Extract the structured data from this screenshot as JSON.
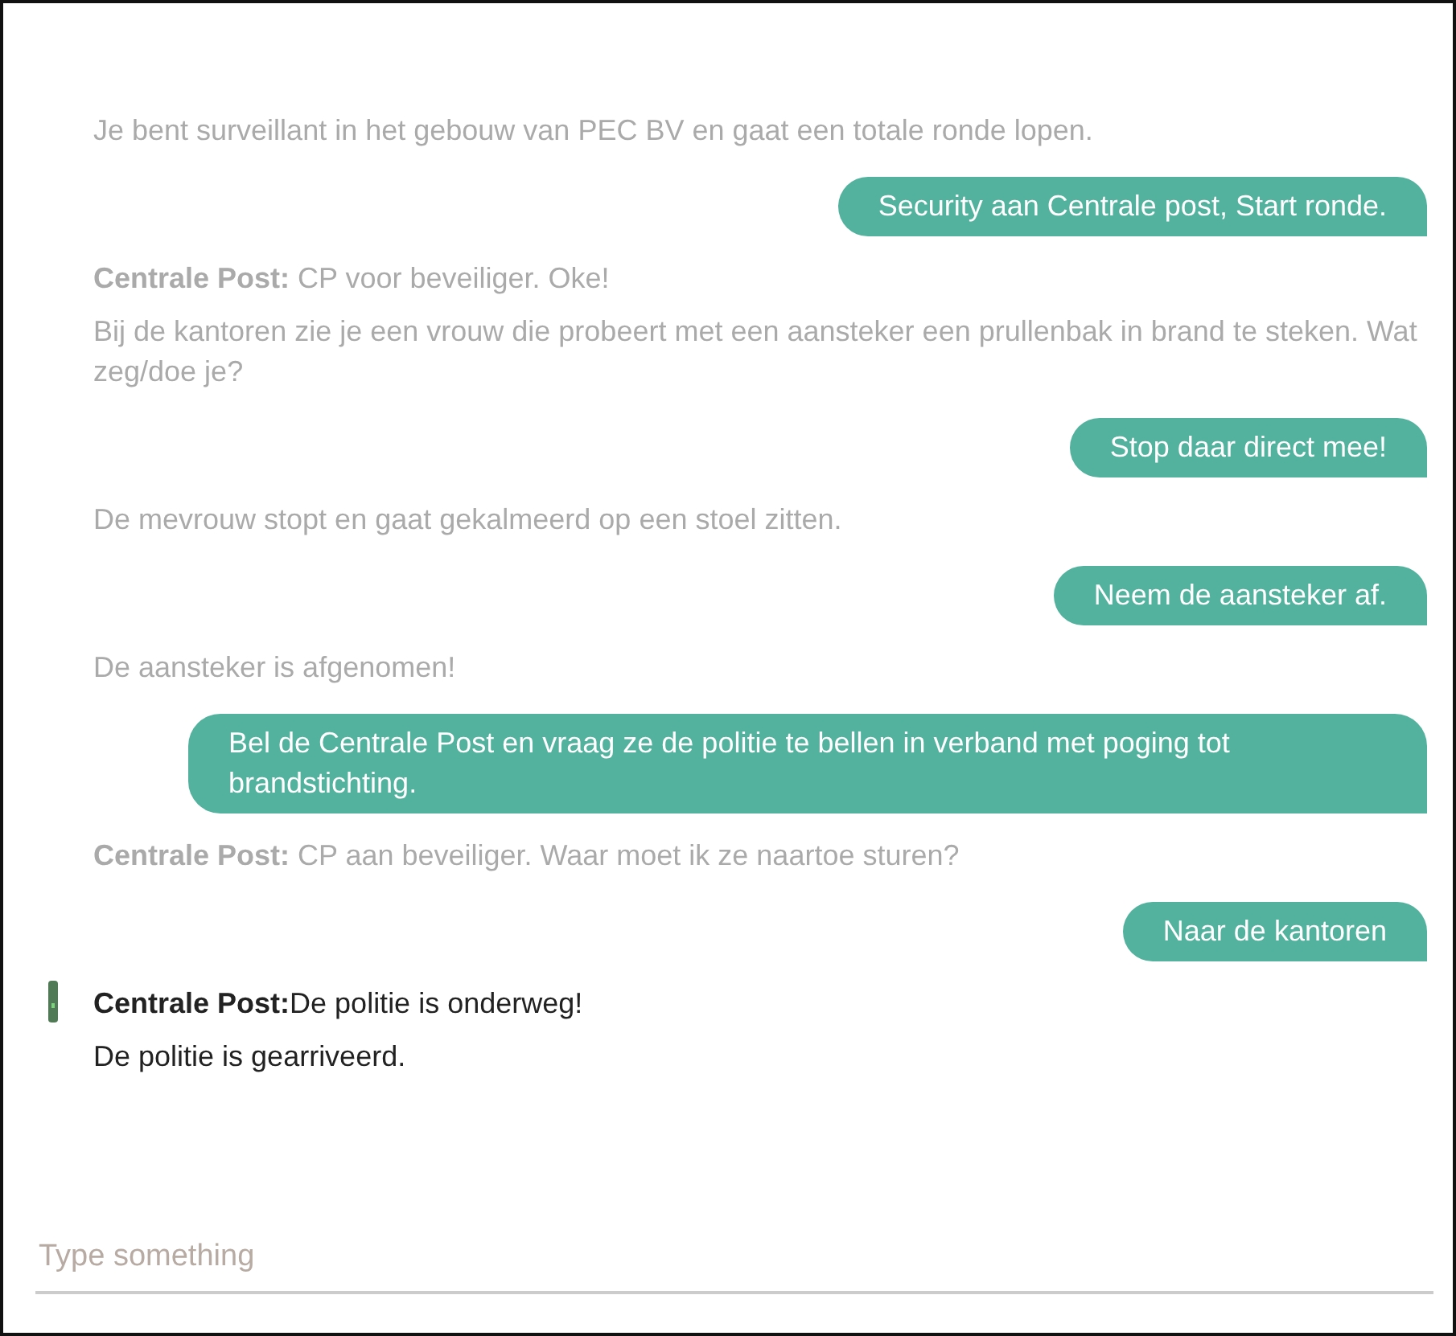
{
  "messages": [
    {
      "kind": "narration",
      "text": "Je bent surveillant in het gebouw van PEC BV en gaat een totale ronde lopen.",
      "faded": true,
      "current": false
    },
    {
      "kind": "reply",
      "text": "Security aan Centrale post, Start ronde."
    },
    {
      "kind": "narration",
      "text": "**Centrale Post:** CP voor beveiliger. Oke!",
      "faded": true,
      "current": false
    },
    {
      "kind": "narration",
      "text": "Bij de kantoren zie je een vrouw die probeert met een aansteker een prullenbak in brand te steken. Wat zeg/doe je?",
      "faded": true,
      "current": false
    },
    {
      "kind": "reply",
      "text": "Stop daar direct mee!"
    },
    {
      "kind": "narration",
      "text": "De mevrouw stopt en gaat gekalmeerd op een stoel zitten.",
      "faded": true,
      "current": false
    },
    {
      "kind": "reply",
      "text": "Neem de aansteker af."
    },
    {
      "kind": "narration",
      "text": "De aansteker is afgenomen!",
      "faded": true,
      "current": false
    },
    {
      "kind": "reply",
      "text": "Bel de Centrale Post en vraag ze de politie te bellen in verband met poging tot brandstichting."
    },
    {
      "kind": "narration",
      "text": "**Centrale Post:** CP aan beveiliger. Waar moet ik ze naartoe sturen?",
      "faded": true,
      "current": false
    },
    {
      "kind": "reply",
      "text": "Naar de kantoren"
    },
    {
      "kind": "narration",
      "text": "**Centrale Post:**De politie is onderweg!",
      "faded": false,
      "current": true
    },
    {
      "kind": "narration",
      "text": "De politie is gearriveerd.",
      "faded": false,
      "current": false
    }
  ],
  "input": {
    "placeholder": "Type something"
  }
}
